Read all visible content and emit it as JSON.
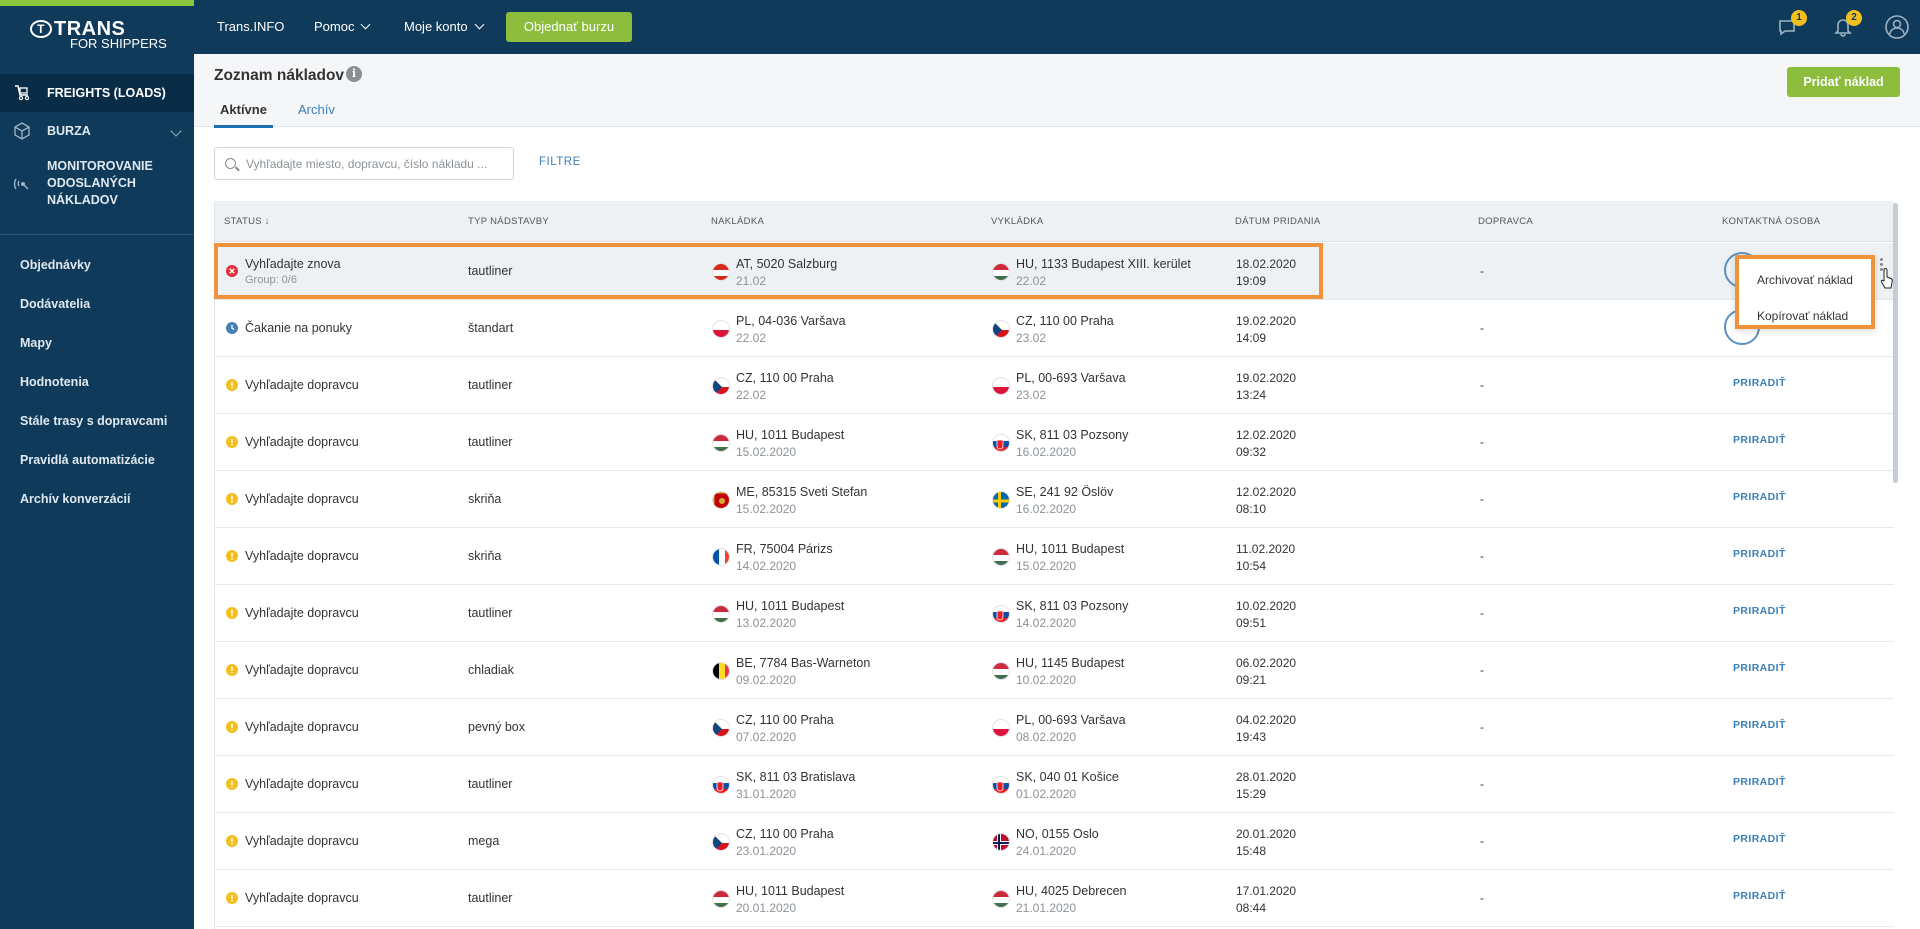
{
  "brand": {
    "logo_trans": "TRANS",
    "logo_paren": "T",
    "logo_sub": "FOR SHIPPERS"
  },
  "sidebar": {
    "main": [
      {
        "label": "FREIGHTS (LOADS)",
        "icon": "truck-loads-icon",
        "active": true
      },
      {
        "label": "BURZA",
        "icon": "box-icon"
      },
      {
        "label": "MONITOROVANIE ODOSLANÝCH NÁKLADOV",
        "icon": "satellite-icon"
      }
    ],
    "sub": [
      "Objednávky",
      "Dodávatelia",
      "Mapy",
      "Hodnotenia",
      "Stále trasy s dopravcami",
      "Pravidlá automatizácie",
      "Archív konverzácií"
    ]
  },
  "topbar": {
    "links": [
      "Trans.INFO",
      "Pomoc",
      "Moje konto"
    ],
    "order_button": "Objednať burzu",
    "messages_badge": "1",
    "notifications_badge": "2"
  },
  "page": {
    "title": "Zoznam nákladov",
    "tabs": [
      "Aktívne",
      "Archív"
    ],
    "add_button": "Pridať náklad",
    "search_placeholder": "Vyhľadajte miesto, dopravcu, číslo nákladu ...",
    "filter_label": "FILTRE"
  },
  "table": {
    "headers": [
      "STATUS ↓",
      "TYP NÁDSTAVBY",
      "NAKLÁDKA",
      "VYKLÁDKA",
      "DÁTUM PRIDANIA",
      "DOPRAVCA",
      "KONTAKTNÁ OSOBA"
    ],
    "rows": [
      {
        "status": "Vyhľadajte znova",
        "group": "Group: 0/6",
        "status_kind": "error",
        "body": "tautliner",
        "load_flag": "AT",
        "load": "AT, 5020 Salzburg",
        "load_date": "21.02",
        "unload_flag": "HU",
        "unload": "HU, 1133 Budapest XIII. kerület",
        "unload_date": "22.02",
        "added_date": "18.02.2020",
        "added_time": "19:09",
        "carrier": "-",
        "contact": ""
      },
      {
        "status": "Čakanie na ponuky",
        "group": "",
        "status_kind": "waiting",
        "body": "štandart",
        "load_flag": "PL",
        "load": "PL, 04-036 Varšava",
        "load_date": "22.02",
        "unload_flag": "CZ",
        "unload": "CZ, 110 00 Praha",
        "unload_date": "23.02",
        "added_date": "19.02.2020",
        "added_time": "14:09",
        "carrier": "-",
        "contact": ""
      },
      {
        "status": "Vyhľadajte dopravcu",
        "group": "",
        "status_kind": "warning",
        "body": "tautliner",
        "load_flag": "CZ",
        "load": "CZ, 110 00 Praha",
        "load_date": "22.02",
        "unload_flag": "PL",
        "unload": "PL, 00-693 Varšava",
        "unload_date": "23.02",
        "added_date": "19.02.2020",
        "added_time": "13:24",
        "carrier": "-",
        "contact": "PRIRADIŤ"
      },
      {
        "status": "Vyhľadajte dopravcu",
        "group": "",
        "status_kind": "warning",
        "body": "tautliner",
        "load_flag": "HU",
        "load": "HU, 1011 Budapest",
        "load_date": "15.02.2020",
        "unload_flag": "SK",
        "unload": "SK, 811 03 Pozsony",
        "unload_date": "16.02.2020",
        "added_date": "12.02.2020",
        "added_time": "09:32",
        "carrier": "-",
        "contact": "PRIRADIŤ"
      },
      {
        "status": "Vyhľadajte dopravcu",
        "group": "",
        "status_kind": "warning",
        "body": "skriňa",
        "load_flag": "ME",
        "load": "ME, 85315 Sveti Stefan",
        "load_date": "15.02.2020",
        "unload_flag": "SE",
        "unload": "SE, 241 92 Öslöv",
        "unload_date": "16.02.2020",
        "added_date": "12.02.2020",
        "added_time": "08:10",
        "carrier": "-",
        "contact": "PRIRADIŤ"
      },
      {
        "status": "Vyhľadajte dopravcu",
        "group": "",
        "status_kind": "warning",
        "body": "skriňa",
        "load_flag": "FR",
        "load": "FR, 75004 Párizs",
        "load_date": "14.02.2020",
        "unload_flag": "HU",
        "unload": "HU, 1011 Budapest",
        "unload_date": "15.02.2020",
        "added_date": "11.02.2020",
        "added_time": "10:54",
        "carrier": "-",
        "contact": "PRIRADIŤ"
      },
      {
        "status": "Vyhľadajte dopravcu",
        "group": "",
        "status_kind": "warning",
        "body": "tautliner",
        "load_flag": "HU",
        "load": "HU, 1011 Budapest",
        "load_date": "13.02.2020",
        "unload_flag": "SK",
        "unload": "SK, 811 03 Pozsony",
        "unload_date": "14.02.2020",
        "added_date": "10.02.2020",
        "added_time": "09:51",
        "carrier": "-",
        "contact": "PRIRADIŤ"
      },
      {
        "status": "Vyhľadajte dopravcu",
        "group": "",
        "status_kind": "warning",
        "body": "chladiak",
        "load_flag": "BE",
        "load": "BE, 7784 Bas-Warneton",
        "load_date": "09.02.2020",
        "unload_flag": "HU",
        "unload": "HU, 1145 Budapest",
        "unload_date": "10.02.2020",
        "added_date": "06.02.2020",
        "added_time": "09:21",
        "carrier": "-",
        "contact": "PRIRADIŤ"
      },
      {
        "status": "Vyhľadajte dopravcu",
        "group": "",
        "status_kind": "warning",
        "body": "pevný box",
        "load_flag": "CZ",
        "load": "CZ, 110 00 Praha",
        "load_date": "07.02.2020",
        "unload_flag": "PL",
        "unload": "PL, 00-693 Varšava",
        "unload_date": "08.02.2020",
        "added_date": "04.02.2020",
        "added_time": "19:43",
        "carrier": "-",
        "contact": "PRIRADIŤ"
      },
      {
        "status": "Vyhľadajte dopravcu",
        "group": "",
        "status_kind": "warning",
        "body": "tautliner",
        "load_flag": "SK",
        "load": "SK, 811 03 Bratislava",
        "load_date": "31.01.2020",
        "unload_flag": "SK",
        "unload": "SK, 040 01 Košice",
        "unload_date": "01.02.2020",
        "added_date": "28.01.2020",
        "added_time": "15:29",
        "carrier": "-",
        "contact": "PRIRADIŤ"
      },
      {
        "status": "Vyhľadajte dopravcu",
        "group": "",
        "status_kind": "warning",
        "body": "mega",
        "load_flag": "CZ",
        "load": "CZ, 110 00 Praha",
        "load_date": "23.01.2020",
        "unload_flag": "NO",
        "unload": "NO, 0155 Oslo",
        "unload_date": "24.01.2020",
        "added_date": "20.01.2020",
        "added_time": "15:48",
        "carrier": "-",
        "contact": "PRIRADIŤ"
      },
      {
        "status": "Vyhľadajte dopravcu",
        "group": "",
        "status_kind": "warning",
        "body": "tautliner",
        "load_flag": "HU",
        "load": "HU, 1011 Budapest",
        "load_date": "20.01.2020",
        "unload_flag": "HU",
        "unload": "HU, 4025 Debrecen",
        "unload_date": "21.01.2020",
        "added_date": "17.01.2020",
        "added_time": "08:44",
        "carrier": "-",
        "contact": "PRIRADIŤ"
      }
    ]
  },
  "context_menu": {
    "items": [
      "Archivovať náklad",
      "Kopírovať náklad"
    ]
  },
  "colors": {
    "sidebar": "#0f3a59",
    "accent_green": "#8cbd3c",
    "link_blue": "#3b80b8",
    "highlight": "#f0923c",
    "warning": "#f2c01e",
    "error": "#e0323c",
    "waiting": "#4a7fb5"
  }
}
